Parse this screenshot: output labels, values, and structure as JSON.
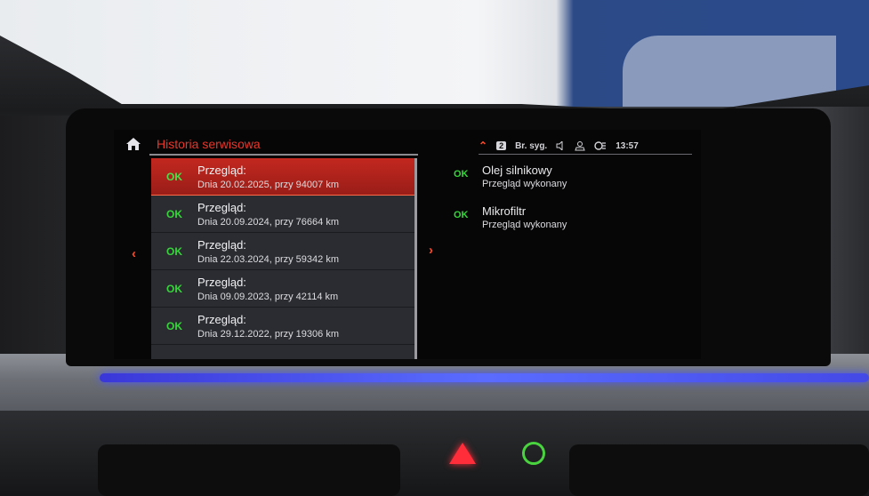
{
  "screen": {
    "title": "Historia serwisowa",
    "status_bar": {
      "profile_number": "2",
      "signal_label": "Br. syg.",
      "time": "13:57",
      "icons": [
        "chevron-up-icon",
        "mute-icon",
        "user-icon",
        "connectivity-icon"
      ]
    },
    "service_list": [
      {
        "status": "OK",
        "title": "Przegląd:",
        "detail": "Dnia 20.02.2025, przy 94007 km",
        "selected": true
      },
      {
        "status": "OK",
        "title": "Przegląd:",
        "detail": "Dnia 20.09.2024, przy 76664 km",
        "selected": false
      },
      {
        "status": "OK",
        "title": "Przegląd:",
        "detail": "Dnia 22.03.2024, przy 59342 km",
        "selected": false
      },
      {
        "status": "OK",
        "title": "Przegląd:",
        "detail": "Dnia 09.09.2023, przy 42114 km",
        "selected": false
      },
      {
        "status": "OK",
        "title": "Przegląd:",
        "detail": "Dnia 29.12.2022, przy 19306 km",
        "selected": false
      }
    ],
    "service_details": [
      {
        "status": "OK",
        "name": "Olej silnikowy",
        "result": "Przegląd wykonany"
      },
      {
        "status": "OK",
        "name": "Mikrofiltr",
        "result": "Przegląd wykonany"
      }
    ]
  },
  "colors": {
    "accent": "#e8362a",
    "ok_green": "#36d63a",
    "ambient_light": "#4a57ff"
  }
}
